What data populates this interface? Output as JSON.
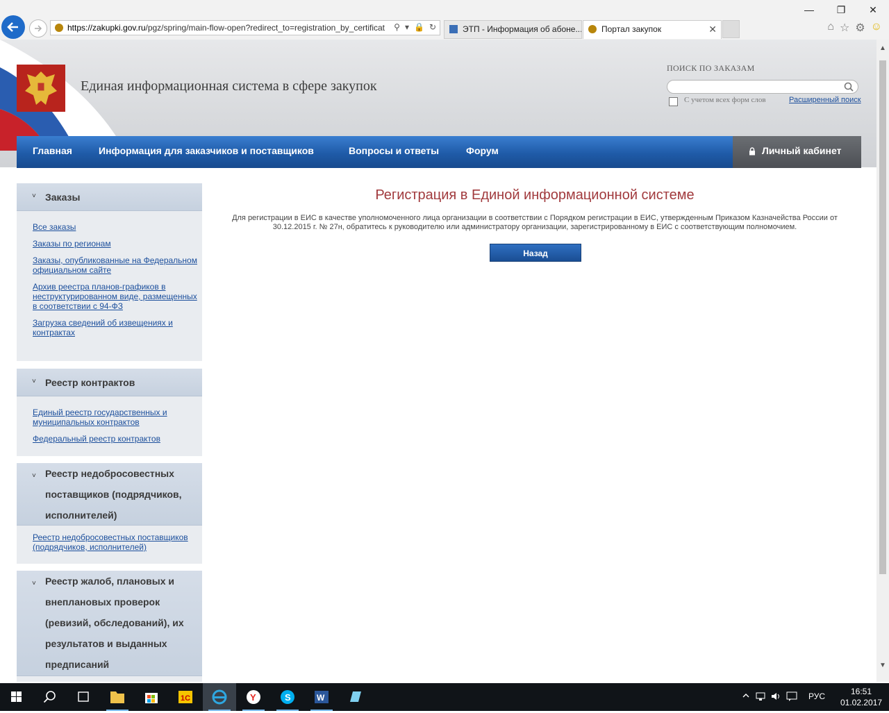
{
  "browser": {
    "url_host": "https://zakupki.gov.ru",
    "url_path": "/pgz/spring/main-flow-open?redirect_to=registration_by_certificat",
    "tabs": [
      {
        "label": "ЭТП - Информация об абоне..."
      },
      {
        "label": "Портал закупок"
      }
    ]
  },
  "header": {
    "site_title": "Единая информационная система в сфере закупок",
    "search_label": "ПОИСК ПО ЗАКАЗАМ",
    "search_value": "",
    "checkbox_label": "С учетом всех форм слов",
    "advanced_search": "Расширенный поиск"
  },
  "topnav": {
    "items": [
      "Главная",
      "Информация для заказчиков и поставщиков",
      "Вопросы и ответы",
      "Форум"
    ],
    "cabinet": "Личный кабинет"
  },
  "sidebar": {
    "blocks": [
      {
        "title_lines": [
          "Заказы"
        ],
        "links": [
          [
            "Все заказы"
          ],
          [
            "Заказы по регионам"
          ],
          [
            "Заказы, опубликованные на Федеральном",
            "официальном сайте"
          ],
          [
            "Архив реестра планов-графиков в",
            "неструктурированном виде, размещенных",
            "в соответствии с 94-ФЗ"
          ],
          [
            "Загрузка сведений об извещениях и",
            "контрактах"
          ]
        ]
      },
      {
        "title_lines": [
          "Реестр контрактов"
        ],
        "links": [
          [
            "Единый реестр государственных и",
            "муниципальных контрактов"
          ],
          [
            "Федеральный реестр контрактов"
          ]
        ]
      },
      {
        "title_lines": [
          "Реестр недобросовестных",
          "поставщиков (подрядчиков,",
          "исполнителей)"
        ],
        "links": [
          [
            "Реестр недобросовестных поставщиков",
            "(подрядчиков, исполнителей)"
          ]
        ]
      },
      {
        "title_lines": [
          "Реестр жалоб, плановых и",
          "внеплановых проверок",
          "(ревизий, обследований), их",
          "результатов и выданных",
          "предписаний"
        ],
        "links": []
      }
    ]
  },
  "main": {
    "title": "Регистрация в Единой информационной системе",
    "text_line1": "Для регистрации в ЕИС в качестве уполномоченного лица организации в соответствии с Порядком регистрации в ЕИС, утвержденным Приказом Казначейства России от",
    "text_line2": "30.12.2015 г. № 27н, обратитесь к руководителю или администратору организации, зарегистрированному в ЕИС с соответствующим полномочием.",
    "back_button": "Назад"
  },
  "taskbar": {
    "lang": "РУС",
    "time": "16:51",
    "date": "01.02.2017"
  },
  "colors": {
    "nav_blue": "#1f5ba8",
    "title_red": "#a13a3d",
    "link_blue": "#1c4f9c"
  }
}
